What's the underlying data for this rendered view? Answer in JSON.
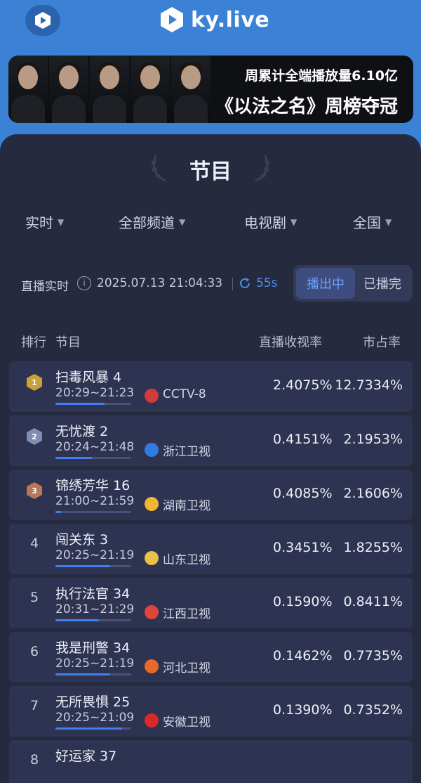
{
  "header": {
    "brand": "ky.live",
    "app_icon": "play-logo-icon"
  },
  "banner": {
    "line1": "周累计全端播放量6.10亿",
    "line2": "《以法之名》周榜夺冠"
  },
  "panel": {
    "title": "节目"
  },
  "filters": [
    {
      "label": "实时"
    },
    {
      "label": "全部频道"
    },
    {
      "label": "电视剧"
    },
    {
      "label": "全国"
    }
  ],
  "status": {
    "label": "直播实时",
    "datetime": "2025.07.13 21:04:33",
    "refresh": "55s",
    "tab_live": "播出中",
    "tab_ended": "已播完"
  },
  "table": {
    "headers": {
      "rank": "排行",
      "program": "节目",
      "rating": "直播收视率",
      "share": "市占率"
    },
    "rows": [
      {
        "rank": "1",
        "name": "扫毒风暴 4",
        "time": "20:29~21:23",
        "channel": "CCTV-8",
        "rating": "2.4075%",
        "share": "12.7334%",
        "progress": 0.65,
        "logo_color": "#d33a3a",
        "medal_color": "#c9a13a"
      },
      {
        "rank": "2",
        "name": "无忧渡 2",
        "time": "20:24~21:48",
        "channel": "浙江卫视",
        "rating": "0.4151%",
        "share": "2.1953%",
        "progress": 0.48,
        "logo_color": "#2f7de0",
        "medal_color": "#7f8cb6"
      },
      {
        "rank": "3",
        "name": "锦绣芳华 16",
        "time": "21:00~21:59",
        "channel": "湖南卫视",
        "rating": "0.4085%",
        "share": "2.1606%",
        "progress": 0.07,
        "logo_color": "#f0b634",
        "medal_color": "#b9775a"
      },
      {
        "rank": "4",
        "name": "闯关东 3",
        "time": "20:25~21:19",
        "channel": "山东卫视",
        "rating": "0.3451%",
        "share": "1.8255%",
        "progress": 0.72,
        "logo_color": "#e9c04a",
        "medal_color": ""
      },
      {
        "rank": "5",
        "name": "执行法官 34",
        "time": "20:31~21:29",
        "channel": "江西卫视",
        "rating": "0.1590%",
        "share": "0.8411%",
        "progress": 0.57,
        "logo_color": "#e0453a",
        "medal_color": ""
      },
      {
        "rank": "6",
        "name": "我是刑警 34",
        "time": "20:25~21:19",
        "channel": "河北卫视",
        "rating": "0.1462%",
        "share": "0.7735%",
        "progress": 0.72,
        "logo_color": "#e56a2e",
        "medal_color": ""
      },
      {
        "rank": "7",
        "name": "无所畏惧 25",
        "time": "20:25~21:09",
        "channel": "安徽卫视",
        "rating": "0.1390%",
        "share": "0.7352%",
        "progress": 0.88,
        "logo_color": "#d92a2a",
        "medal_color": ""
      },
      {
        "rank": "8",
        "name": "好运家 37",
        "time": "",
        "channel": "",
        "rating": "",
        "share": "",
        "progress": 0,
        "logo_color": "",
        "medal_color": ""
      }
    ]
  }
}
